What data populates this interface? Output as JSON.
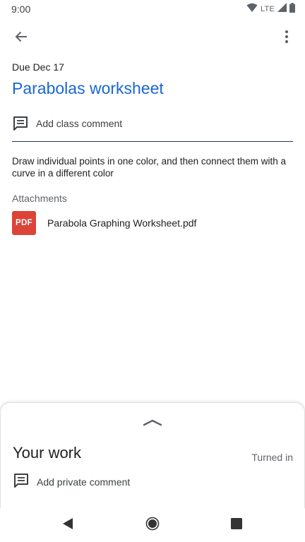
{
  "status_bar": {
    "time": "9:00",
    "network": "LTE",
    "icons": [
      "wifi-icon",
      "signal-icon",
      "battery-icon"
    ]
  },
  "app_bar": {
    "back_icon": "arrow-back-icon",
    "menu_icon": "more-vert-icon"
  },
  "assignment": {
    "due": "Due Dec 17",
    "title": "Parabolas worksheet",
    "class_comment_label": "Add class comment",
    "description": "Draw individual points in one color, and then connect them with a curve in a different color",
    "attachments_heading": "Attachments",
    "attachments": [
      {
        "icon_text": "PDF",
        "name": "Parabola Graphing Worksheet.pdf"
      }
    ]
  },
  "your_work": {
    "title": "Your work",
    "status": "Turned in",
    "private_comment_label": "Add private comment"
  },
  "colors": {
    "title": "#1967d2",
    "pdf_badge": "#db4437",
    "divider": "#1a3b6e"
  },
  "nav_bar": {
    "icons": [
      "back-triangle-icon",
      "home-circle-icon",
      "recents-square-icon"
    ]
  }
}
